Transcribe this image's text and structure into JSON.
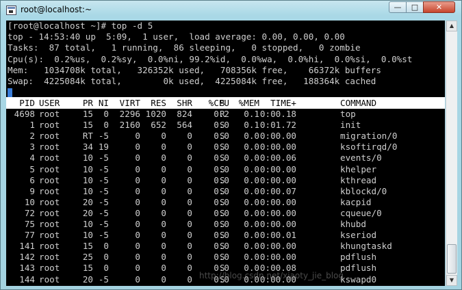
{
  "window": {
    "title": "root@localhost:~",
    "minimize_label": "—",
    "maximize_label": "□",
    "close_label": "✕"
  },
  "terminal": {
    "prompt_line": "[root@localhost ~]# top -d 5",
    "summary": [
      "top - 14:53:40 up  5:09,  1 user,  load average: 0.00, 0.00, 0.00",
      "Tasks:  87 total,   1 running,  86 sleeping,   0 stopped,   0 zombie",
      "Cpu(s):  0.2%us,  0.2%sy,  0.0%ni, 99.2%id,  0.0%wa,  0.0%hi,  0.0%si,  0.0%st",
      "Mem:   1034708k total,   326352k used,   708356k free,    66372k buffers",
      "Swap:  4225084k total,        0k used,  4225084k free,   188364k cached"
    ],
    "columns": [
      "PID",
      "USER",
      "PR",
      "NI",
      "VIRT",
      "RES",
      "SHR",
      "S",
      "%CPU",
      "%MEM",
      "TIME+",
      "COMMAND"
    ],
    "processes": [
      [
        "4698",
        "root",
        "15",
        "0",
        "2296",
        "1020",
        "824",
        "R",
        "0.2",
        "0.1",
        "0:00.18",
        "top"
      ],
      [
        "1",
        "root",
        "15",
        "0",
        "2160",
        "652",
        "564",
        "S",
        "0.0",
        "0.1",
        "0:01.72",
        "init"
      ],
      [
        "2",
        "root",
        "RT",
        "-5",
        "0",
        "0",
        "0",
        "S",
        "0.0",
        "0.0",
        "0:00.00",
        "migration/0"
      ],
      [
        "3",
        "root",
        "34",
        "19",
        "0",
        "0",
        "0",
        "S",
        "0.0",
        "0.0",
        "0:00.00",
        "ksoftirqd/0"
      ],
      [
        "4",
        "root",
        "10",
        "-5",
        "0",
        "0",
        "0",
        "S",
        "0.0",
        "0.0",
        "0:00.06",
        "events/0"
      ],
      [
        "5",
        "root",
        "10",
        "-5",
        "0",
        "0",
        "0",
        "S",
        "0.0",
        "0.0",
        "0:00.00",
        "khelper"
      ],
      [
        "6",
        "root",
        "10",
        "-5",
        "0",
        "0",
        "0",
        "S",
        "0.0",
        "0.0",
        "0:00.00",
        "kthread"
      ],
      [
        "9",
        "root",
        "10",
        "-5",
        "0",
        "0",
        "0",
        "S",
        "0.0",
        "0.0",
        "0:00.07",
        "kblockd/0"
      ],
      [
        "10",
        "root",
        "20",
        "-5",
        "0",
        "0",
        "0",
        "S",
        "0.0",
        "0.0",
        "0:00.00",
        "kacpid"
      ],
      [
        "72",
        "root",
        "20",
        "-5",
        "0",
        "0",
        "0",
        "S",
        "0.0",
        "0.0",
        "0:00.00",
        "cqueue/0"
      ],
      [
        "75",
        "root",
        "10",
        "-5",
        "0",
        "0",
        "0",
        "S",
        "0.0",
        "0.0",
        "0:00.00",
        "khubd"
      ],
      [
        "77",
        "root",
        "10",
        "-5",
        "0",
        "0",
        "0",
        "S",
        "0.0",
        "0.0",
        "0:00.01",
        "kseriod"
      ],
      [
        "141",
        "root",
        "15",
        "0",
        "0",
        "0",
        "0",
        "S",
        "0.0",
        "0.0",
        "0:00.00",
        "khungtaskd"
      ],
      [
        "142",
        "root",
        "25",
        "0",
        "0",
        "0",
        "0",
        "S",
        "0.0",
        "0.0",
        "0:00.00",
        "pdflush"
      ],
      [
        "143",
        "root",
        "15",
        "0",
        "0",
        "0",
        "0",
        "S",
        "0.0",
        "0.0",
        "0:00.08",
        "pdflush"
      ],
      [
        "144",
        "root",
        "20",
        "-5",
        "0",
        "0",
        "0",
        "S",
        "0.0",
        "0.0",
        "0:00.00",
        "kswapd0"
      ]
    ]
  },
  "watermark": "http://blog.csdn.net/xiaoty_jie_blog",
  "colors": {
    "terminal_bg": "#000000",
    "terminal_fg": "#cfcfcf",
    "header_bg": "#ffffff",
    "cursor": "#3a7dd8",
    "frame": "#a9d8e6",
    "close_button": "#c7452c"
  }
}
